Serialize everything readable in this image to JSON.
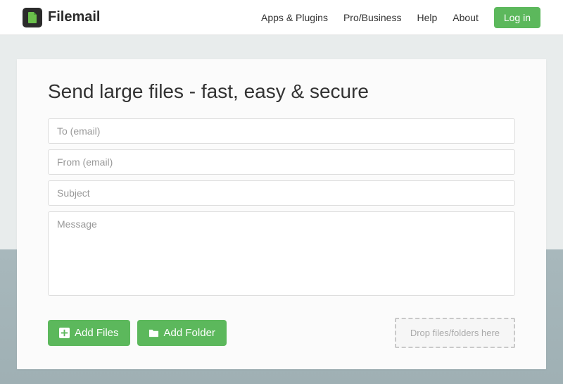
{
  "brand": {
    "name": "Filemail"
  },
  "nav": {
    "apps": "Apps & Plugins",
    "pro": "Pro/Business",
    "help": "Help",
    "about": "About",
    "login": "Log in"
  },
  "form": {
    "heading": "Send large files - fast, easy & secure",
    "to_placeholder": "To (email)",
    "from_placeholder": "From (email)",
    "subject_placeholder": "Subject",
    "message_placeholder": "Message",
    "add_files_label": "Add Files",
    "add_folder_label": "Add Folder",
    "dropzone_text": "Drop files/folders here"
  }
}
